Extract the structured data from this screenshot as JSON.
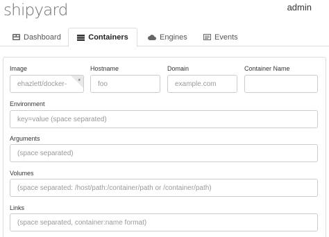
{
  "brand": "shipyard",
  "user": "admin",
  "tabs": [
    {
      "label": "Dashboard",
      "icon": "dashboard-icon"
    },
    {
      "label": "Containers",
      "icon": "containers-icon",
      "active": true
    },
    {
      "label": "Engines",
      "icon": "cloud-icon"
    },
    {
      "label": "Events",
      "icon": "events-icon"
    }
  ],
  "form": {
    "image": {
      "label": "Image",
      "value": "ehazlett/docker-",
      "required_mark": "*"
    },
    "hostname": {
      "label": "Hostname",
      "placeholder": "foo"
    },
    "domain": {
      "label": "Domain",
      "placeholder": "example.com"
    },
    "container_name": {
      "label": "Container Name",
      "placeholder": ""
    },
    "environment": {
      "label": "Environment",
      "placeholder": "key=value (space separated)"
    },
    "arguments": {
      "label": "Arguments",
      "placeholder": "(space separated)"
    },
    "volumes": {
      "label": "Volumes",
      "placeholder": "(space separated: /host/path:/container/path or /container/path)"
    },
    "links": {
      "label": "Links",
      "placeholder": "(space separated, container:name format)"
    }
  },
  "colors": {
    "border": "#cccccc",
    "tab_border": "#dddddd",
    "brand": "#6e6e6e"
  }
}
